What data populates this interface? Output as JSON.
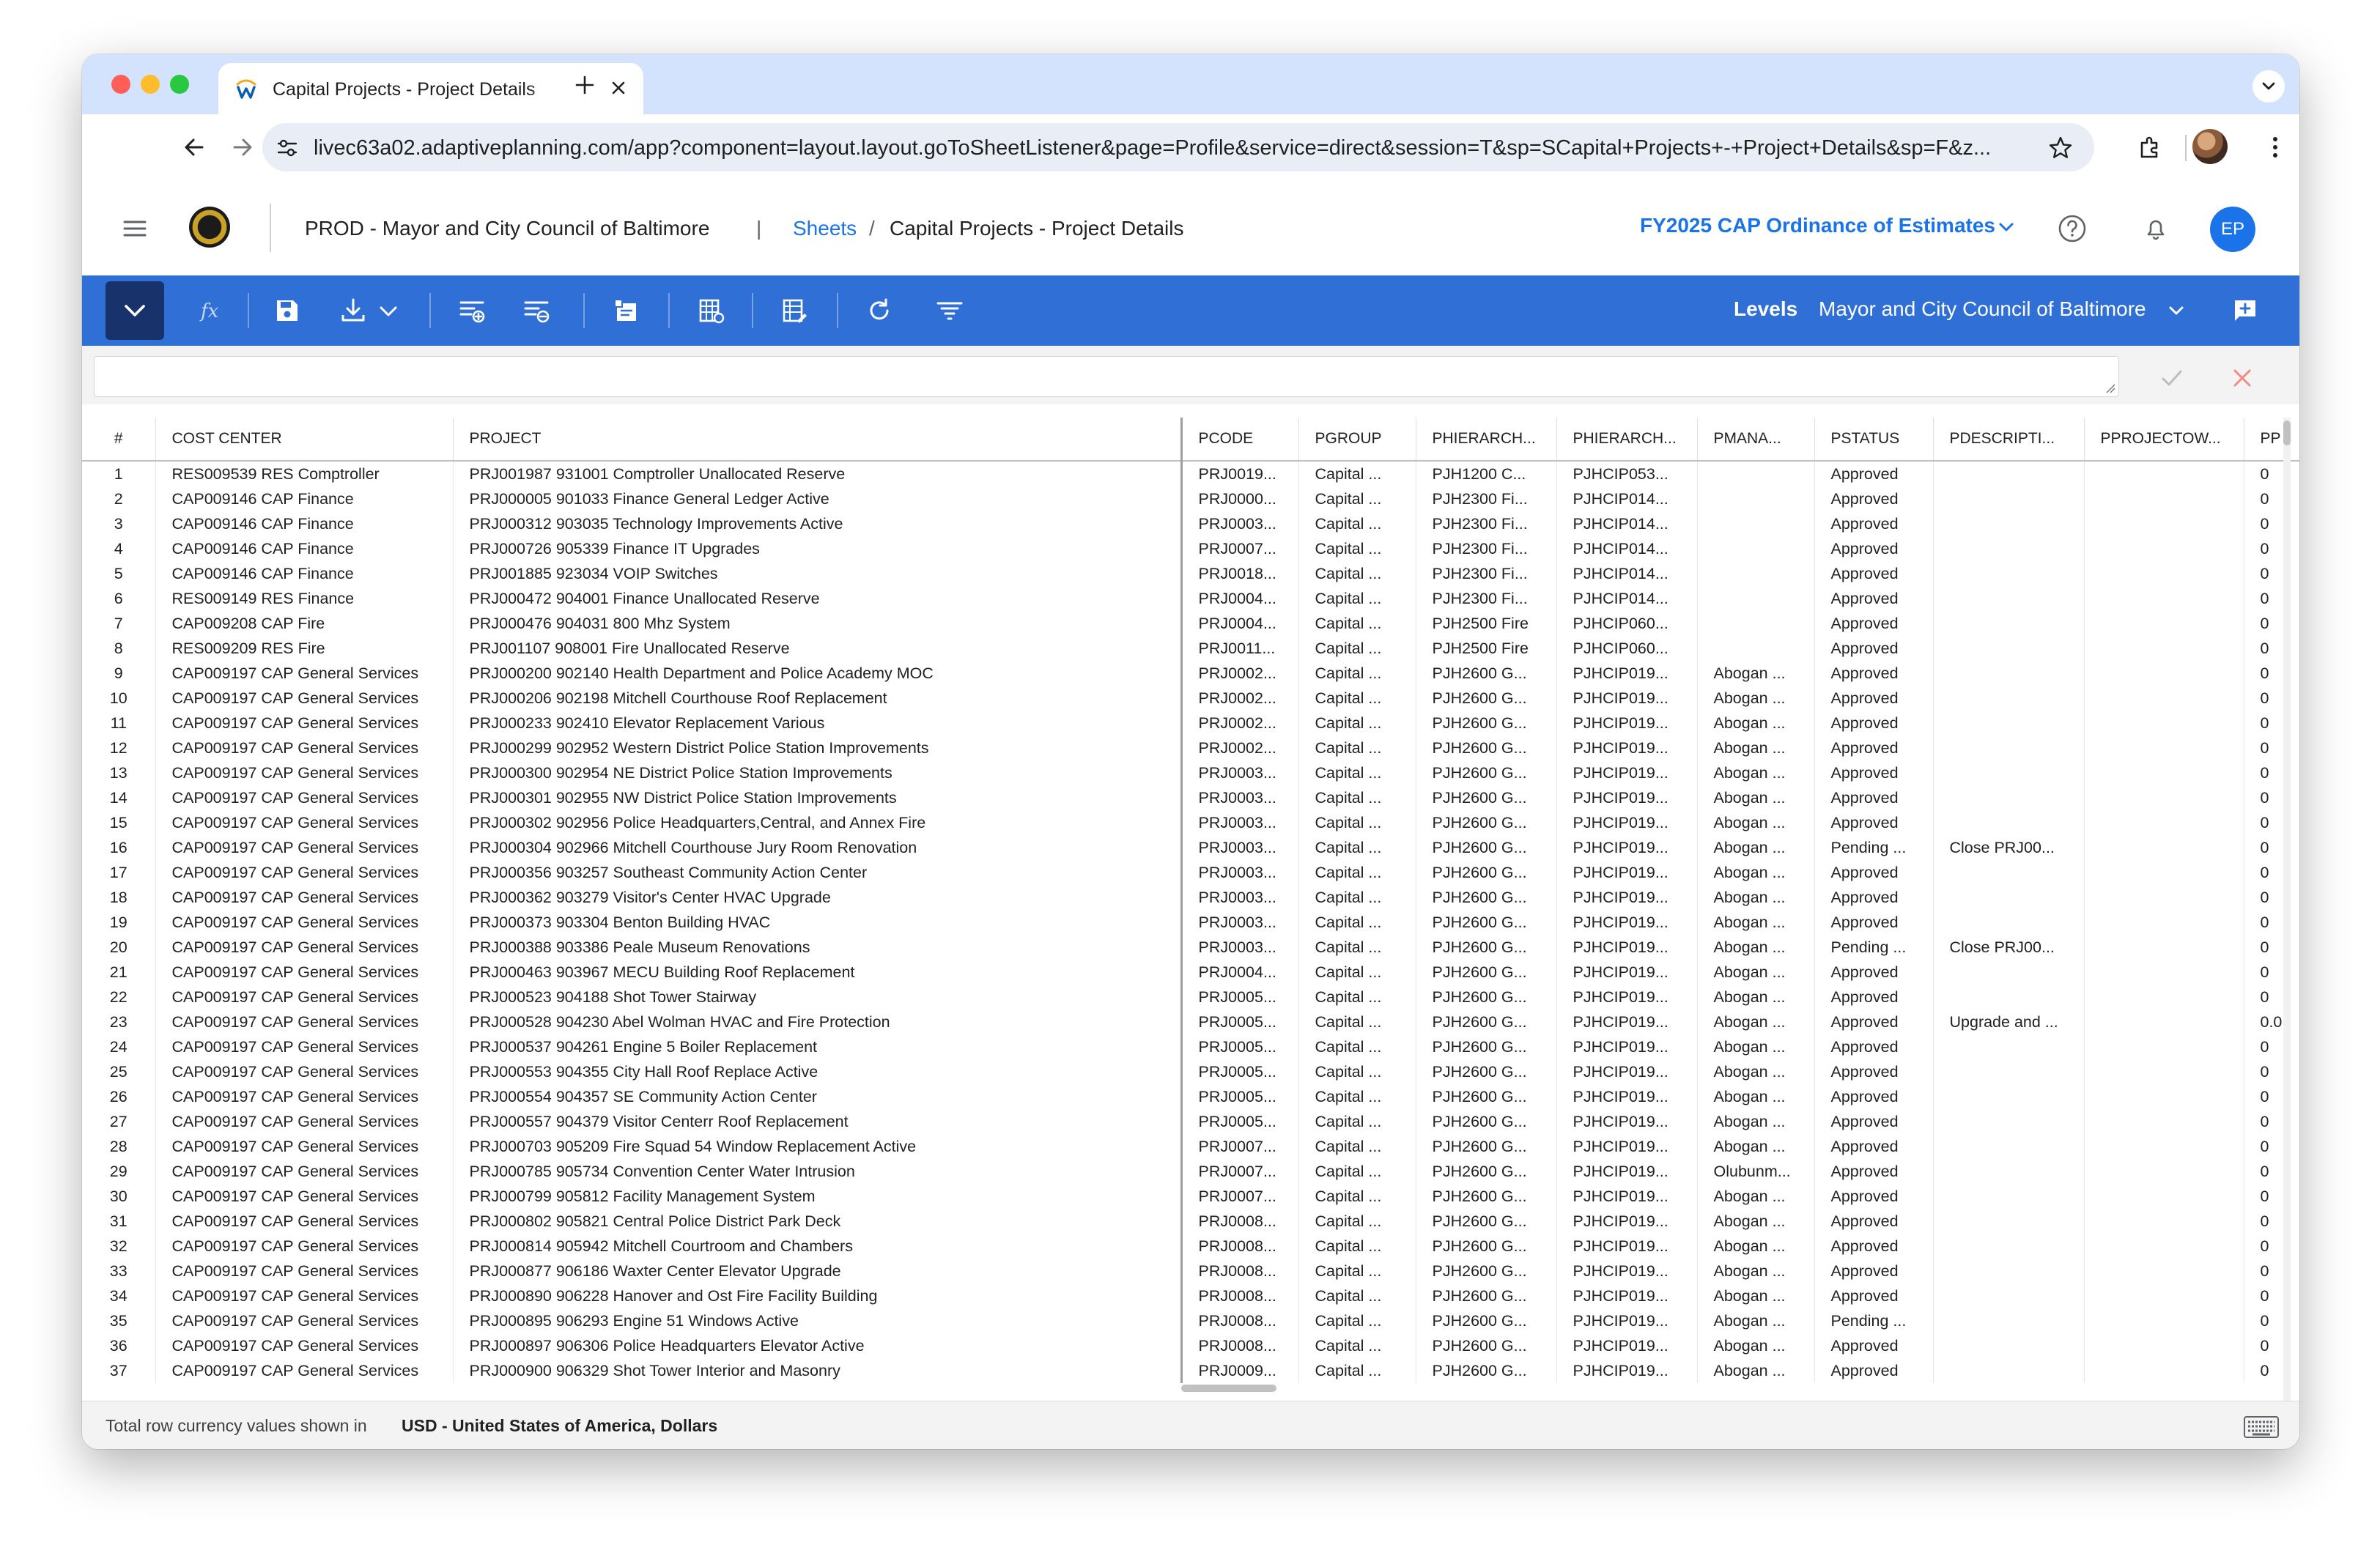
{
  "browser": {
    "tab_title": "Capital Projects - Project Details",
    "url": "livec63a02.adaptiveplanning.com/app?component=layout.layout.goToSheetListener&page=Profile&service=direct&session=T&sp=SCapital+Projects+-+Project+Details&sp=F&z..."
  },
  "header": {
    "tenant": "PROD - Mayor and City Council of Baltimore",
    "breadcrumb_sheets": "Sheets",
    "breadcrumb_sep": "/",
    "breadcrumb_page": "Capital Projects - Project Details",
    "version": "FY2025 CAP Ordinance of Estimates",
    "user_initials": "EP"
  },
  "toolbar": {
    "levels_label": "Levels",
    "levels_value": "Mayor and City Council of Baltimore"
  },
  "grid": {
    "columns": [
      "#",
      "COST CENTER",
      "PROJECT",
      "PCODE",
      "PGROUP",
      "PHIERARCH...",
      "PHIERARCH...",
      "PMANA...",
      "PSTATUS",
      "PDESCRIPTI...",
      "PPROJECTOW...",
      "PP"
    ],
    "rows": [
      [
        "1",
        "RES009539 RES Comptroller",
        "PRJ001987 931001 Comptroller Unallocated Reserve",
        "PRJ0019...",
        "Capital ...",
        "PJH1200 C...",
        "PJHCIP053...",
        "",
        "Approved",
        "",
        "",
        "0"
      ],
      [
        "2",
        "CAP009146 CAP Finance",
        "PRJ000005 901033 Finance General Ledger Active",
        "PRJ0000...",
        "Capital ...",
        "PJH2300 Fi...",
        "PJHCIP014...",
        "",
        "Approved",
        "",
        "",
        "0"
      ],
      [
        "3",
        "CAP009146 CAP Finance",
        "PRJ000312 903035 Technology Improvements Active",
        "PRJ0003...",
        "Capital ...",
        "PJH2300 Fi...",
        "PJHCIP014...",
        "",
        "Approved",
        "",
        "",
        "0"
      ],
      [
        "4",
        "CAP009146 CAP Finance",
        "PRJ000726 905339 Finance IT Upgrades",
        "PRJ0007...",
        "Capital ...",
        "PJH2300 Fi...",
        "PJHCIP014...",
        "",
        "Approved",
        "",
        "",
        "0"
      ],
      [
        "5",
        "CAP009146 CAP Finance",
        "PRJ001885 923034 VOIP Switches",
        "PRJ0018...",
        "Capital ...",
        "PJH2300 Fi...",
        "PJHCIP014...",
        "",
        "Approved",
        "",
        "",
        "0"
      ],
      [
        "6",
        "RES009149 RES Finance",
        "PRJ000472 904001 Finance Unallocated Reserve",
        "PRJ0004...",
        "Capital ...",
        "PJH2300 Fi...",
        "PJHCIP014...",
        "",
        "Approved",
        "",
        "",
        "0"
      ],
      [
        "7",
        "CAP009208 CAP Fire",
        "PRJ000476 904031 800 Mhz System",
        "PRJ0004...",
        "Capital ...",
        "PJH2500 Fire",
        "PJHCIP060...",
        "",
        "Approved",
        "",
        "",
        "0"
      ],
      [
        "8",
        "RES009209 RES Fire",
        "PRJ001107 908001 Fire Unallocated Reserve",
        "PRJ0011...",
        "Capital ...",
        "PJH2500 Fire",
        "PJHCIP060...",
        "",
        "Approved",
        "",
        "",
        "0"
      ],
      [
        "9",
        "CAP009197 CAP General Services",
        "PRJ000200 902140 Health Department and  Police Academy MOC",
        "PRJ0002...",
        "Capital ...",
        "PJH2600 G...",
        "PJHCIP019...",
        "Abogan ...",
        "Approved",
        "",
        "",
        "0"
      ],
      [
        "10",
        "CAP009197 CAP General Services",
        "PRJ000206 902198 Mitchell Courthouse Roof Replacement",
        "PRJ0002...",
        "Capital ...",
        "PJH2600 G...",
        "PJHCIP019...",
        "Abogan ...",
        "Approved",
        "",
        "",
        "0"
      ],
      [
        "11",
        "CAP009197 CAP General Services",
        "PRJ000233 902410 Elevator Replacement Various",
        "PRJ0002...",
        "Capital ...",
        "PJH2600 G...",
        "PJHCIP019...",
        "Abogan ...",
        "Approved",
        "",
        "",
        "0"
      ],
      [
        "12",
        "CAP009197 CAP General Services",
        "PRJ000299 902952 Western District Police Station Improvements",
        "PRJ0002...",
        "Capital ...",
        "PJH2600 G...",
        "PJHCIP019...",
        "Abogan ...",
        "Approved",
        "",
        "",
        "0"
      ],
      [
        "13",
        "CAP009197 CAP General Services",
        "PRJ000300 902954 NE District Police Station Improvements",
        "PRJ0003...",
        "Capital ...",
        "PJH2600 G...",
        "PJHCIP019...",
        "Abogan ...",
        "Approved",
        "",
        "",
        "0"
      ],
      [
        "14",
        "CAP009197 CAP General Services",
        "PRJ000301 902955 NW District Police Station Improvements",
        "PRJ0003...",
        "Capital ...",
        "PJH2600 G...",
        "PJHCIP019...",
        "Abogan ...",
        "Approved",
        "",
        "",
        "0"
      ],
      [
        "15",
        "CAP009197 CAP General Services",
        "PRJ000302 902956 Police Headquarters,Central, and Annex Fire",
        "PRJ0003...",
        "Capital ...",
        "PJH2600 G...",
        "PJHCIP019...",
        "Abogan ...",
        "Approved",
        "",
        "",
        "0"
      ],
      [
        "16",
        "CAP009197 CAP General Services",
        "PRJ000304 902966 Mitchell Courthouse Jury Room Renovation",
        "PRJ0003...",
        "Capital ...",
        "PJH2600 G...",
        "PJHCIP019...",
        "Abogan ...",
        "Pending ...",
        "Close PRJ00...",
        "",
        "0"
      ],
      [
        "17",
        "CAP009197 CAP General Services",
        "PRJ000356 903257 Southeast Community Action Center",
        "PRJ0003...",
        "Capital ...",
        "PJH2600 G...",
        "PJHCIP019...",
        "Abogan ...",
        "Approved",
        "",
        "",
        "0"
      ],
      [
        "18",
        "CAP009197 CAP General Services",
        "PRJ000362 903279 Visitor's Center HVAC Upgrade",
        "PRJ0003...",
        "Capital ...",
        "PJH2600 G...",
        "PJHCIP019...",
        "Abogan ...",
        "Approved",
        "",
        "",
        "0"
      ],
      [
        "19",
        "CAP009197 CAP General Services",
        "PRJ000373 903304 Benton Building HVAC",
        "PRJ0003...",
        "Capital ...",
        "PJH2600 G...",
        "PJHCIP019...",
        "Abogan ...",
        "Approved",
        "",
        "",
        "0"
      ],
      [
        "20",
        "CAP009197 CAP General Services",
        "PRJ000388 903386 Peale Museum Renovations",
        "PRJ0003...",
        "Capital ...",
        "PJH2600 G...",
        "PJHCIP019...",
        "Abogan ...",
        "Pending ...",
        "Close PRJ00...",
        "",
        "0"
      ],
      [
        "21",
        "CAP009197 CAP General Services",
        "PRJ000463 903967 MECU Building Roof Replacement",
        "PRJ0004...",
        "Capital ...",
        "PJH2600 G...",
        "PJHCIP019...",
        "Abogan ...",
        "Approved",
        "",
        "",
        "0"
      ],
      [
        "22",
        "CAP009197 CAP General Services",
        "PRJ000523 904188 Shot Tower Stairway",
        "PRJ0005...",
        "Capital ...",
        "PJH2600 G...",
        "PJHCIP019...",
        "Abogan ...",
        "Approved",
        "",
        "",
        "0"
      ],
      [
        "23",
        "CAP009197 CAP General Services",
        "PRJ000528 904230 Abel Wolman HVAC and Fire Protection",
        "PRJ0005...",
        "Capital ...",
        "PJH2600 G...",
        "PJHCIP019...",
        "Abogan ...",
        "Approved",
        "Upgrade and ...",
        "",
        "0.0"
      ],
      [
        "24",
        "CAP009197 CAP General Services",
        "PRJ000537 904261 Engine 5 Boiler Replacement",
        "PRJ0005...",
        "Capital ...",
        "PJH2600 G...",
        "PJHCIP019...",
        "Abogan ...",
        "Approved",
        "",
        "",
        "0"
      ],
      [
        "25",
        "CAP009197 CAP General Services",
        "PRJ000553 904355 City Hall Roof Replace Active",
        "PRJ0005...",
        "Capital ...",
        "PJH2600 G...",
        "PJHCIP019...",
        "Abogan ...",
        "Approved",
        "",
        "",
        "0"
      ],
      [
        "26",
        "CAP009197 CAP General Services",
        "PRJ000554 904357 SE Community Action Center",
        "PRJ0005...",
        "Capital ...",
        "PJH2600 G...",
        "PJHCIP019...",
        "Abogan ...",
        "Approved",
        "",
        "",
        "0"
      ],
      [
        "27",
        "CAP009197 CAP General Services",
        "PRJ000557 904379 Visitor Centerr Roof Replacement",
        "PRJ0005...",
        "Capital ...",
        "PJH2600 G...",
        "PJHCIP019...",
        "Abogan ...",
        "Approved",
        "",
        "",
        "0"
      ],
      [
        "28",
        "CAP009197 CAP General Services",
        "PRJ000703 905209 Fire Squad 54 Window Replacement  Active",
        "PRJ0007...",
        "Capital ...",
        "PJH2600 G...",
        "PJHCIP019...",
        "Abogan ...",
        "Approved",
        "",
        "",
        "0"
      ],
      [
        "29",
        "CAP009197 CAP General Services",
        "PRJ000785 905734 Convention Center Water Intrusion",
        "PRJ0007...",
        "Capital ...",
        "PJH2600 G...",
        "PJHCIP019...",
        "Olubunm...",
        "Approved",
        "",
        "",
        "0"
      ],
      [
        "30",
        "CAP009197 CAP General Services",
        "PRJ000799 905812 Facility Management System",
        "PRJ0007...",
        "Capital ...",
        "PJH2600 G...",
        "PJHCIP019...",
        "Abogan ...",
        "Approved",
        "",
        "",
        "0"
      ],
      [
        "31",
        "CAP009197 CAP General Services",
        "PRJ000802 905821 Central Police District Park Deck",
        "PRJ0008...",
        "Capital ...",
        "PJH2600 G...",
        "PJHCIP019...",
        "Abogan ...",
        "Approved",
        "",
        "",
        "0"
      ],
      [
        "32",
        "CAP009197 CAP General Services",
        "PRJ000814 905942 Mitchell Courtroom and Chambers",
        "PRJ0008...",
        "Capital ...",
        "PJH2600 G...",
        "PJHCIP019...",
        "Abogan ...",
        "Approved",
        "",
        "",
        "0"
      ],
      [
        "33",
        "CAP009197 CAP General Services",
        "PRJ000877 906186 Waxter Center Elevator Upgrade",
        "PRJ0008...",
        "Capital ...",
        "PJH2600 G...",
        "PJHCIP019...",
        "Abogan ...",
        "Approved",
        "",
        "",
        "0"
      ],
      [
        "34",
        "CAP009197 CAP General Services",
        "PRJ000890 906228 Hanover and Ost Fire Facility Building",
        "PRJ0008...",
        "Capital ...",
        "PJH2600 G...",
        "PJHCIP019...",
        "Abogan ...",
        "Approved",
        "",
        "",
        "0"
      ],
      [
        "35",
        "CAP009197 CAP General Services",
        "PRJ000895 906293 Engine 51 Windows Active",
        "PRJ0008...",
        "Capital ...",
        "PJH2600 G...",
        "PJHCIP019...",
        "Abogan ...",
        "Pending ...",
        "",
        "",
        "0"
      ],
      [
        "36",
        "CAP009197 CAP General Services",
        "PRJ000897 906306 Police Headquarters Elevator Active",
        "PRJ0008...",
        "Capital ...",
        "PJH2600 G...",
        "PJHCIP019...",
        "Abogan ...",
        "Approved",
        "",
        "",
        "0"
      ],
      [
        "37",
        "CAP009197 CAP General Services",
        "PRJ000900 906329 Shot Tower Interior and Masonry",
        "PRJ0009...",
        "Capital ...",
        "PJH2600 G...",
        "PJHCIP019...",
        "Abogan ...",
        "Approved",
        "",
        "",
        "0"
      ]
    ]
  },
  "footer": {
    "label": "Total row currency values shown in",
    "currency": "USD - United States of America, Dollars"
  },
  "colors": {
    "toolbar_blue": "#2f6fd6",
    "collapse_navy": "#18336b",
    "link_blue": "#1a73e8",
    "tab_strip": "#d3e3fd"
  }
}
